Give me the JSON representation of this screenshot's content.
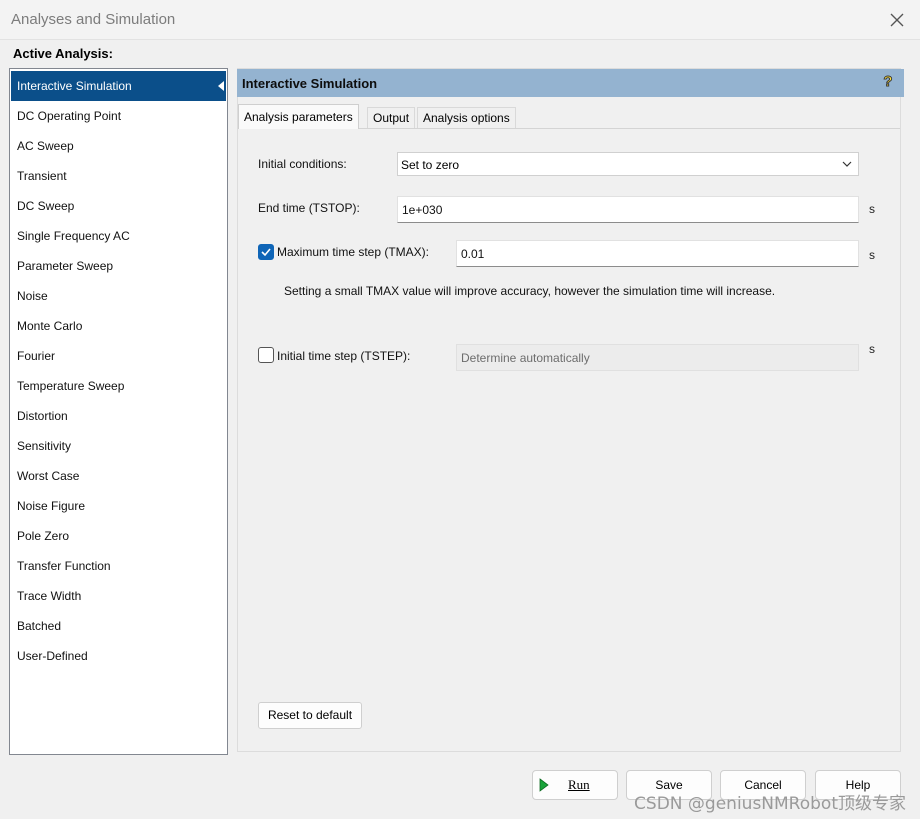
{
  "window": {
    "title": "Analyses and Simulation",
    "close_icon": "close-icon"
  },
  "active_analysis_label": "Active Analysis:",
  "analyses": [
    {
      "label": "Interactive Simulation",
      "selected": true
    },
    {
      "label": "DC Operating Point"
    },
    {
      "label": "AC Sweep"
    },
    {
      "label": "Transient"
    },
    {
      "label": "DC Sweep"
    },
    {
      "label": "Single Frequency AC"
    },
    {
      "label": "Parameter Sweep"
    },
    {
      "label": "Noise"
    },
    {
      "label": "Monte Carlo"
    },
    {
      "label": "Fourier"
    },
    {
      "label": "Temperature Sweep"
    },
    {
      "label": "Distortion"
    },
    {
      "label": "Sensitivity"
    },
    {
      "label": "Worst Case"
    },
    {
      "label": "Noise Figure"
    },
    {
      "label": "Pole Zero"
    },
    {
      "label": "Transfer Function"
    },
    {
      "label": "Trace Width"
    },
    {
      "label": "Batched"
    },
    {
      "label": "User-Defined"
    }
  ],
  "panel": {
    "title": "Interactive Simulation",
    "help_icon": "help-icon",
    "tabs": [
      "Analysis parameters",
      "Output",
      "Analysis options"
    ],
    "active_tab": "Analysis parameters"
  },
  "params": {
    "initial_conditions": {
      "label": "Initial conditions:",
      "value": "Set to zero"
    },
    "end_time": {
      "label": "End time (TSTOP):",
      "value": "1e+030",
      "unit": "s"
    },
    "max_step": {
      "label": "Maximum time step (TMAX):",
      "value": "0.01",
      "unit": "s",
      "checked": true
    },
    "hint": "Setting a small TMAX value will improve accuracy, however the simulation time will increase.",
    "init_step": {
      "label": "Initial time step (TSTEP):",
      "value": "Determine automatically",
      "unit": "s",
      "checked": false
    }
  },
  "reset_label": "Reset to default",
  "buttons": {
    "run": "Run",
    "save": "Save",
    "cancel": "Cancel",
    "help": "Help"
  },
  "watermark": "CSDN @geniusNMRobot顶级专家",
  "colors": {
    "selection": "#0b4f8a",
    "header_band": "#94b3d0",
    "checkbox": "#0f65b7",
    "run_arrow": "#19a33a"
  }
}
